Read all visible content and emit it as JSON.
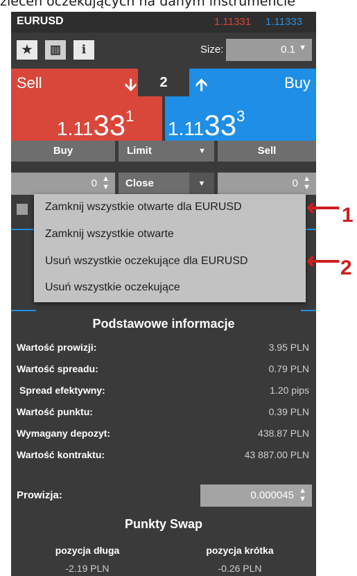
{
  "caption": "zleceń oczekujących na danym instrumencie",
  "header": {
    "symbol": "EURUSD",
    "bid": "1.11331",
    "ask": "1.11333"
  },
  "toolbar": {
    "star_icon": "★",
    "chart_icon": "▥",
    "info_icon": "i",
    "size_label": "Size:",
    "size_value": "0.1",
    "size_caret": "▼"
  },
  "trade": {
    "sell_label": "Sell",
    "buy_label": "Buy",
    "spread": "2",
    "sell_arrow": "🡫",
    "buy_arrow": "🡩",
    "sell_price": {
      "a": "1.11",
      "b": "33",
      "c": "1"
    },
    "buy_price": {
      "a": "1.11",
      "b": "33",
      "c": "3"
    }
  },
  "order": {
    "buy_btn": "Buy",
    "type_btn": "Limit",
    "type_caret": "▼",
    "sell_btn": "Sell",
    "left_qty": "0",
    "close_label": "Close",
    "close_caret": "▼",
    "right_qty": "0",
    "stepper_glyph": "▲▼"
  },
  "close_menu": {
    "items": [
      "Zamknij wszystkie otwarte dla EURUSD",
      "Zamknij wszystkie otwarte",
      "Usuń wszystkie oczekujące dla EURUSD",
      "Usuń wszystkie oczekujące"
    ]
  },
  "annotations": {
    "marker_1": "1",
    "marker_2": "2",
    "arrow": "⟵"
  },
  "info": {
    "title": "Podstawowe informacje",
    "rows": [
      {
        "label": "Wartość prowizji:",
        "value": "3.95 PLN"
      },
      {
        "label": "Wartość spreadu:",
        "value": "0.79 PLN"
      },
      {
        "label": "Spread efektywny:",
        "value": "1.20 pips"
      },
      {
        "label": "Wartość punktu:",
        "value": "0.39 PLN"
      },
      {
        "label": "Wymagany depozyt:",
        "value": "438.87 PLN"
      },
      {
        "label": "Wartość kontraktu:",
        "value": "43 887.00 PLN"
      }
    ],
    "commission_label": "Prowizja:",
    "commission_value": "0.000045"
  },
  "swap": {
    "title": "Punkty Swap",
    "long_label": "pozycja długa",
    "long_value": "-2.19 PLN",
    "short_label": "pozycja krótka",
    "short_value": "-0.26 PLN"
  }
}
